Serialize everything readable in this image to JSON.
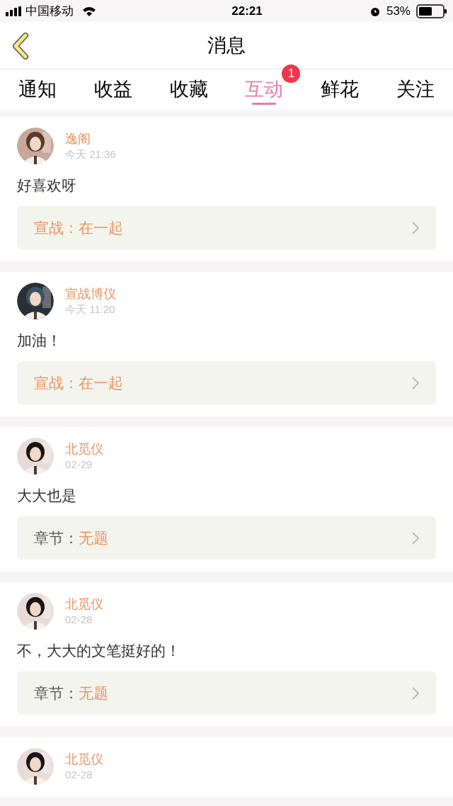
{
  "status_bar": {
    "carrier": "中国移动",
    "time": "22:21",
    "battery": "53%"
  },
  "nav": {
    "title": "消息"
  },
  "tabs": [
    {
      "label": "通知",
      "selected": false
    },
    {
      "label": "收益",
      "selected": false
    },
    {
      "label": "收藏",
      "selected": false
    },
    {
      "label": "互动",
      "selected": true,
      "badge": "1"
    },
    {
      "label": "鲜花",
      "selected": false
    },
    {
      "label": "关注",
      "selected": false
    }
  ],
  "messages": [
    {
      "name": "逸阁",
      "time": "今天 21:36",
      "text": "好喜欢呀",
      "ref": {
        "kind": "battle",
        "label": "宣战：",
        "value": "在一起"
      }
    },
    {
      "name": "宣战博仪",
      "time": "今天 11:20",
      "text": "加油！",
      "ref": {
        "kind": "battle",
        "label": "宣战：",
        "value": "在一起"
      }
    },
    {
      "name": "北觅仪",
      "time": "02-29",
      "text": "大大也是",
      "ref": {
        "kind": "chapter",
        "label": "章节：",
        "value": "无题"
      }
    },
    {
      "name": "北觅仪",
      "time": "02-28",
      "text": "不，大大的文笔挺好的！",
      "ref": {
        "kind": "chapter",
        "label": "章节：",
        "value": "无题"
      }
    },
    {
      "name": "北觅仪",
      "time": "02-28"
    }
  ]
}
